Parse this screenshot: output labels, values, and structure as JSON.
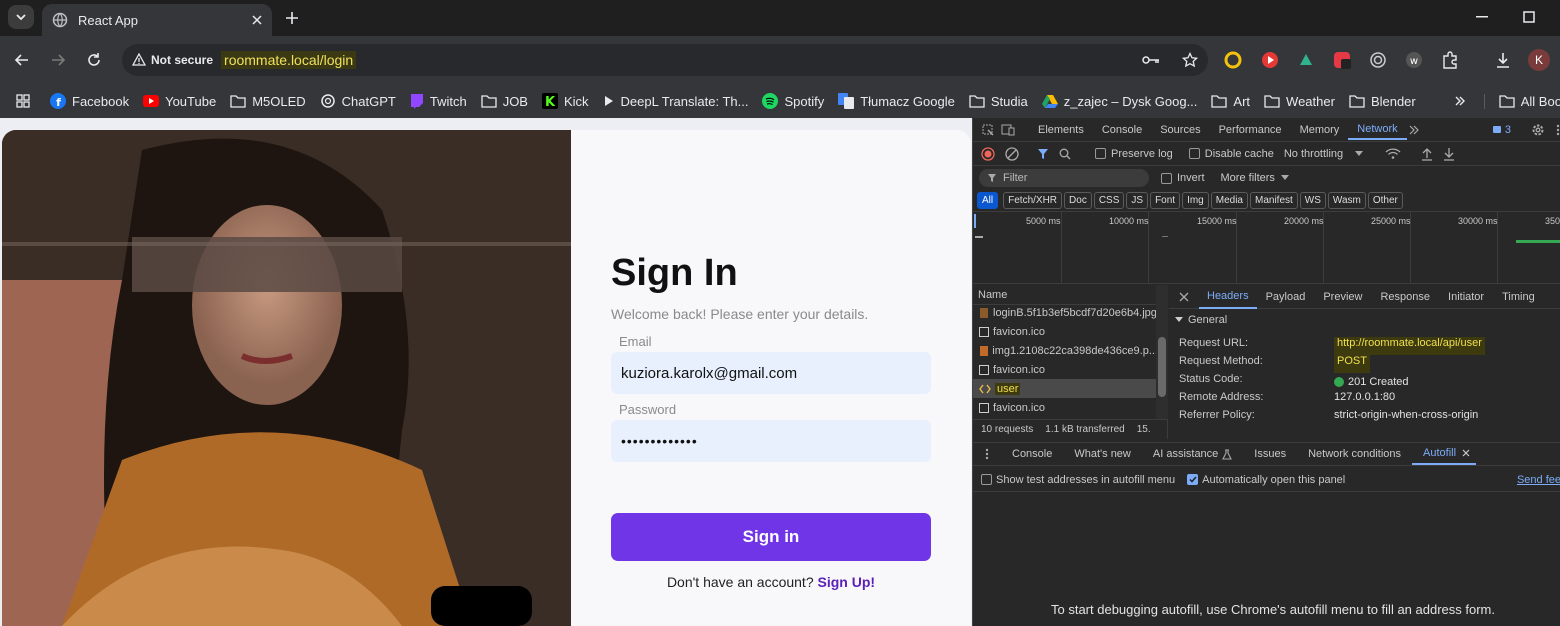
{
  "browser": {
    "tab_title": "React App",
    "security_label": "Not secure",
    "url": "roommate.local/login",
    "profile_initial": "K"
  },
  "bookmarks": [
    {
      "label": "Facebook",
      "icon": "facebook-icon"
    },
    {
      "label": "YouTube",
      "icon": "youtube-icon"
    },
    {
      "label": "M5OLED",
      "icon": "folder-icon"
    },
    {
      "label": "ChatGPT",
      "icon": "chatgpt-icon"
    },
    {
      "label": "Twitch",
      "icon": "twitch-icon"
    },
    {
      "label": "JOB",
      "icon": "folder-icon"
    },
    {
      "label": "Kick",
      "icon": "kick-icon"
    },
    {
      "label": "DeepL Translate: Th...",
      "icon": "deepl-icon"
    },
    {
      "label": "Spotify",
      "icon": "spotify-icon"
    },
    {
      "label": "Tłumacz Google",
      "icon": "google-translate-icon"
    },
    {
      "label": "Studia",
      "icon": "folder-icon"
    },
    {
      "label": "z_zajec – Dysk Goog...",
      "icon": "google-drive-icon"
    },
    {
      "label": "Art",
      "icon": "folder-icon"
    },
    {
      "label": "Weather",
      "icon": "folder-icon"
    },
    {
      "label": "Blender",
      "icon": "folder-icon"
    }
  ],
  "bookmarks_all": "All Bookm",
  "page": {
    "title": "Sign In",
    "subtitle": "Welcome back! Please enter your details.",
    "email_label": "Email",
    "email_value": "kuziora.karolx@gmail.com",
    "password_label": "Password",
    "password_value": "•••••••••••••",
    "submit_label": "Sign in",
    "signup_prompt": "Don't have an account?",
    "signup_link": "Sign Up!",
    "accent": "#7c3aed"
  },
  "devtools": {
    "tabs": [
      "Elements",
      "Console",
      "Sources",
      "Performance",
      "Memory",
      "Network"
    ],
    "active_tab": "Network",
    "issues_count": "3",
    "preserve_log": "Preserve log",
    "disable_cache": "Disable cache",
    "throttling": "No throttling",
    "filter_placeholder": "Filter",
    "invert": "Invert",
    "more_filters": "More filters",
    "type_filters": [
      "All",
      "Fetch/XHR",
      "Doc",
      "CSS",
      "JS",
      "Font",
      "Img",
      "Media",
      "Manifest",
      "WS",
      "Wasm",
      "Other"
    ],
    "timeline_ticks": [
      "5000 ms",
      "10000 ms",
      "15000 ms",
      "20000 ms",
      "25000 ms",
      "30000 ms",
      "350"
    ],
    "name_header": "Name",
    "requests": [
      {
        "name": "loginB.5f1b3ef5bcdf7d20e6b4.jpg"
      },
      {
        "name": "favicon.ico"
      },
      {
        "name": "img1.2108c22ca398de436ce9.p..."
      },
      {
        "name": "favicon.ico"
      },
      {
        "name": "user"
      },
      {
        "name": "favicon.ico"
      }
    ],
    "summary": [
      "10 requests",
      "1.1 kB transferred",
      "15."
    ],
    "detail_tabs": [
      "Headers",
      "Payload",
      "Preview",
      "Response",
      "Initiator",
      "Timing"
    ],
    "section": "General",
    "headers": {
      "request_url_label": "Request URL:",
      "request_url": "http://roommate.local/api/user",
      "method_label": "Request Method:",
      "method": "POST",
      "status_label": "Status Code:",
      "status": "201 Created",
      "remote_label": "Remote Address:",
      "remote": "127.0.0.1:80",
      "referrer_label": "Referrer Policy:",
      "referrer": "strict-origin-when-cross-origin"
    },
    "drawer_tabs": [
      "Console",
      "What's new",
      "AI assistance",
      "Issues",
      "Network conditions",
      "Autofill"
    ],
    "autofill_show_test": "Show test addresses in autofill menu",
    "autofill_auto_open": "Automatically open this panel",
    "send_feedback": "Send fee",
    "autofill_message": "To start debugging autofill, use Chrome's autofill menu to fill an address form."
  }
}
